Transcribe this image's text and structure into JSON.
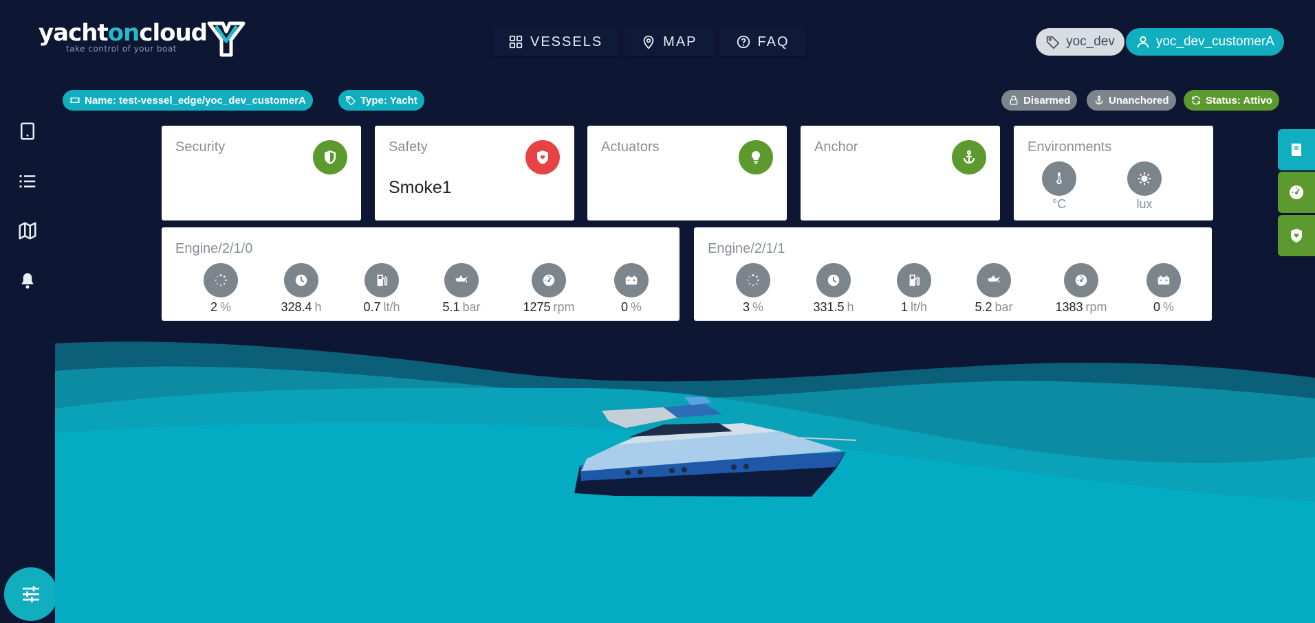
{
  "brand": {
    "name_a": "yacht",
    "name_b": "on",
    "name_c": "cloud",
    "tagline": "take control of your boat"
  },
  "nav": [
    {
      "label": "VESSELS",
      "icon": "grid-icon"
    },
    {
      "label": "MAP",
      "icon": "map-pin-icon"
    },
    {
      "label": "FAQ",
      "icon": "help-circle-icon"
    }
  ],
  "user": {
    "tenant": "yoc_dev",
    "account": "yoc_dev_customerA"
  },
  "badges": {
    "name": "Name: test-vessel_edge/yoc_dev_customerA",
    "type": "Type: Yacht",
    "armed": "Disarmed",
    "anchor": "Unanchored",
    "status": "Status: Attivo"
  },
  "cards": {
    "security": {
      "title": "Security",
      "value": ""
    },
    "safety": {
      "title": "Safety",
      "value": "Smoke1"
    },
    "actuators": {
      "title": "Actuators",
      "value": ""
    },
    "anchor": {
      "title": "Anchor",
      "value": ""
    },
    "environments": {
      "title": "Environments",
      "temp_unit": "°C",
      "light_unit": "lux"
    }
  },
  "engines": [
    {
      "title": "Engine/2/1/0",
      "metrics": [
        {
          "icon": "load-spinner-icon",
          "value": "2",
          "unit": "%"
        },
        {
          "icon": "clock-icon",
          "value": "328.4",
          "unit": "h"
        },
        {
          "icon": "fuel-icon",
          "value": "0.7",
          "unit": "lt/h"
        },
        {
          "icon": "oil-can-icon",
          "value": "5.1",
          "unit": "bar"
        },
        {
          "icon": "speedometer-icon",
          "value": "1275",
          "unit": "rpm"
        },
        {
          "icon": "battery-icon",
          "value": "0",
          "unit": "%"
        }
      ]
    },
    {
      "title": "Engine/2/1/1",
      "metrics": [
        {
          "icon": "load-spinner-icon",
          "value": "3",
          "unit": "%"
        },
        {
          "icon": "clock-icon",
          "value": "331.5",
          "unit": "h"
        },
        {
          "icon": "fuel-icon",
          "value": "1",
          "unit": "lt/h"
        },
        {
          "icon": "oil-can-icon",
          "value": "5.2",
          "unit": "bar"
        },
        {
          "icon": "speedometer-icon",
          "value": "1383",
          "unit": "rpm"
        },
        {
          "icon": "battery-icon",
          "value": "0",
          "unit": "%"
        }
      ]
    }
  ],
  "colors": {
    "background": "#0d1632",
    "accent": "#10aebf",
    "ok": "#5c9a2f",
    "alarm": "#e84344",
    "neutral": "#7d858c"
  }
}
